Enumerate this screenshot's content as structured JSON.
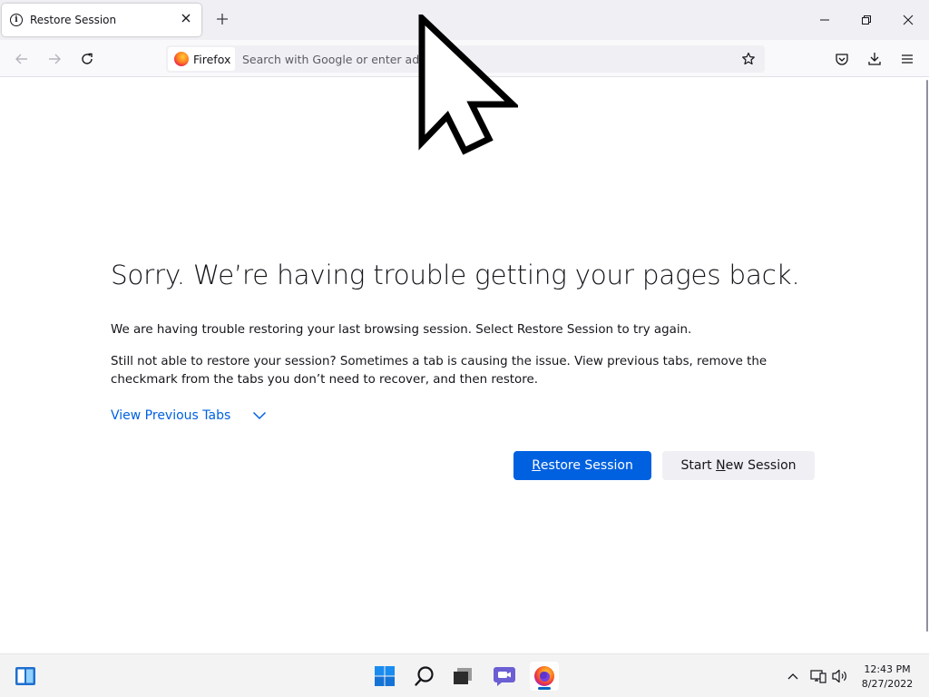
{
  "tab": {
    "title": "Restore Session"
  },
  "urlbar": {
    "identity_label": "Firefox",
    "placeholder": "Search with Google or enter address"
  },
  "content": {
    "title": "Sorry. We’re having trouble getting your pages back.",
    "para1": "We are having trouble restoring your last browsing session. Select Restore Session to try again.",
    "para2": "Still not able to restore your session? Sometimes a tab is causing the issue. View previous tabs, remove the checkmark from the tabs you don’t need to recover, and then restore.",
    "view_previous_label": "View Previous Tabs",
    "restore_button": {
      "prefix": "",
      "access_key": "R",
      "suffix": "estore Session"
    },
    "new_session_button": {
      "prefix": "Start ",
      "access_key": "N",
      "suffix": "ew Session"
    }
  },
  "taskbar": {
    "clock_time": "12:43 PM",
    "clock_date": "8/27/2022"
  },
  "colors": {
    "accent": "#0061e0",
    "tabstrip_bg": "#f0f0f4",
    "secondary_button_bg": "#f0f0f4",
    "taskbar_indicator": "#0067c0"
  },
  "icons": {
    "tab": "info-icon",
    "window_controls": [
      "minimize-icon",
      "restore-icon",
      "close-icon"
    ],
    "nav": [
      "back-arrow-icon",
      "forward-arrow-icon",
      "reload-icon"
    ],
    "urlbar": [
      "firefox-logo-icon",
      "bookmark-star-icon"
    ],
    "toolbar": [
      "pocket-icon",
      "download-icon",
      "hamburger-menu-icon"
    ],
    "taskbar": [
      "widgets-icon",
      "windows-start-icon",
      "search-icon",
      "task-view-icon",
      "chat-icon",
      "firefox-icon"
    ],
    "tray": [
      "chevron-up-icon",
      "network-icon",
      "volume-icon"
    ]
  }
}
